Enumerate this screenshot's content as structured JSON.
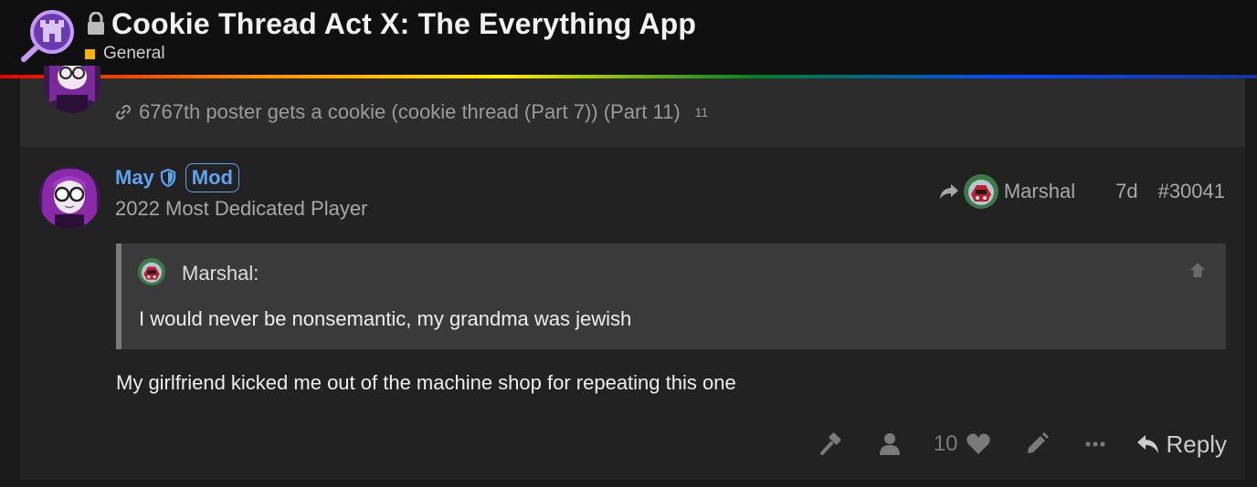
{
  "header": {
    "title": "Cookie Thread Act X: The Everything App",
    "category": "General",
    "category_color": "#f2b600",
    "logo_icon": "castle-magnifier-logo",
    "locked": true
  },
  "previous_post": {
    "link_text": "6767th poster gets a cookie (cookie thread (Part 7)) (Part 11)",
    "link_clicks": "11"
  },
  "post": {
    "username": "May",
    "badge": "Mod",
    "user_title": "2022 Most Dedicated Player",
    "reply_to": "Marshal",
    "age": "7d",
    "post_number": "#30041",
    "quote": {
      "author": "Marshal:",
      "text": "I would never be nonsemantic, my grandma was jewish"
    },
    "body": "My girlfriend kicked me out of the machine shop for repeating this one",
    "actions": {
      "like_count": "10",
      "reply_label": "Reply"
    }
  },
  "colors": {
    "accent": "#5da3f0",
    "background": "#1a1a1a",
    "post_background": "#222222",
    "quote_background": "#3a3a3a"
  }
}
